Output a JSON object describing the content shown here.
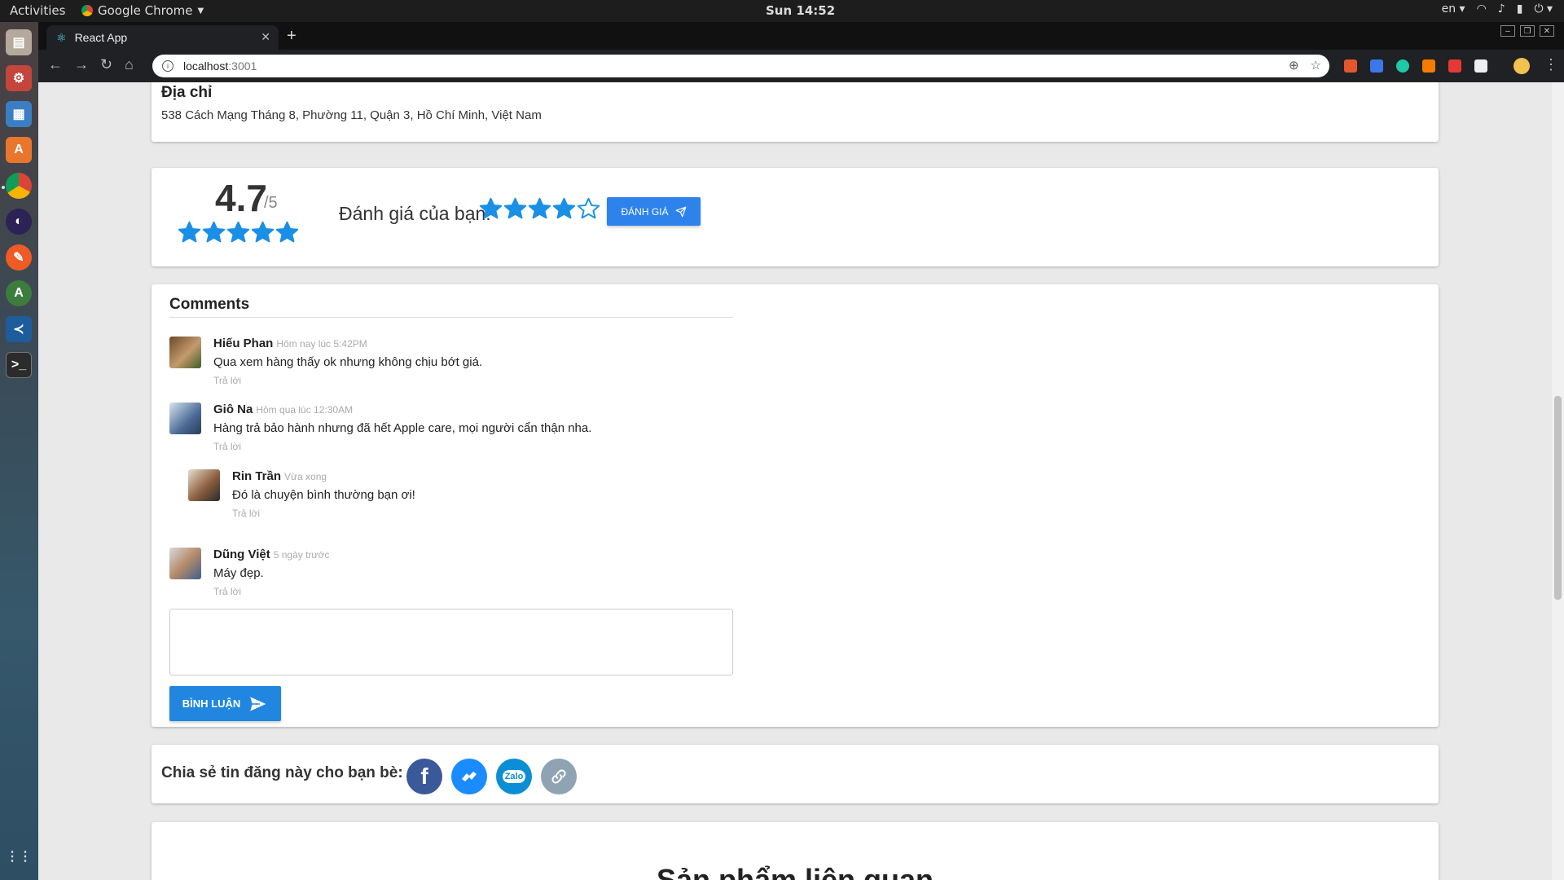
{
  "system_bar": {
    "activities": "Activities",
    "app_name": "Google Chrome",
    "clock": "Sun 14:52",
    "lang": "en"
  },
  "browser": {
    "tab_title": "React App",
    "url_host": "localhost",
    "url_port": ":3001"
  },
  "address": {
    "heading": "Địa chỉ",
    "value": "538 Cách Mạng Tháng 8, Phường 11, Quận 3, Hồ Chí Minh, Việt Nam"
  },
  "rating": {
    "average": "4.7",
    "max": "/5",
    "average_stars": 5,
    "your_label": "Đánh giá của bạn:",
    "your_stars_filled": 4,
    "your_stars_total": 5,
    "button_label": "ĐÁNH GIÁ",
    "star_color": "#1a8fe6"
  },
  "comments": {
    "title": "Comments",
    "items": [
      {
        "author": "Hiếu Phan",
        "time": "Hôm nay lúc 5:42PM",
        "text": "Qua xem hàng thấy ok nhưng không chịu bớt giá.",
        "reply": "Trả lời"
      },
      {
        "author": "Giô Na",
        "time": "Hôm qua lúc 12:30AM",
        "text": "Hàng trả bảo hành nhưng đã hết Apple care, mọi người cẩn thận nha.",
        "reply": "Trả lời"
      },
      {
        "author": "Rin Trần",
        "time": "Vừa xong",
        "text": "Đó là chuyện bình thường bạn ơi!",
        "reply": "Trả lời"
      },
      {
        "author": "Dũng Việt",
        "time": "5 ngày trước",
        "text": "Máy đẹp.",
        "reply": "Trả lời"
      }
    ],
    "input_value": "",
    "submit_label": "BÌNH LUẬN"
  },
  "share": {
    "label": "Chia sẻ tin đăng này cho bạn bè:",
    "zalo_text": "Zalo",
    "icons": [
      "facebook-icon",
      "messenger-icon",
      "zalo-icon",
      "link-icon"
    ]
  },
  "related": {
    "title": "Sản phẩm liên quan"
  },
  "colors": {
    "primary_button": "#2d82eb",
    "facebook": "#3b5998",
    "messenger": "#1a8cff"
  }
}
